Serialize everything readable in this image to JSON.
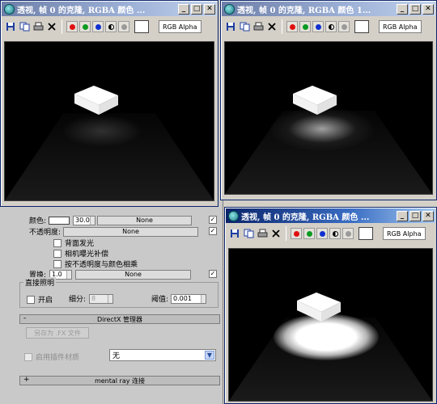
{
  "material_panel": {
    "color_label": "颜色:",
    "color_value": "30.0",
    "none_1": "None",
    "opacity_label": "不透明度:",
    "none_2": "None",
    "backface_label": "背面发光",
    "camera_exposure_label": "相机曝光补偿",
    "opacity_multiply_label": "按不透明度与颜色相乘",
    "displace_label": "置换:",
    "displace_value": "1.0",
    "none_3": "None",
    "direct_light_group": "直接照明",
    "enable_label": "开启",
    "subdiv_label": "细分:",
    "subdiv_value": "8",
    "threshold_label": "阈值:",
    "threshold_value": "0.001",
    "directx_rollout": "DirectX 管理器",
    "directx_rollout_sign": "-",
    "save_fx_button": "另存为 .FX 文件",
    "enable_plugin_label": "启用插件材质",
    "plugin_select_value": "无",
    "mentalray_rollout": "mental ray 连接",
    "mentalray_rollout_sign": "+"
  },
  "windows": [
    {
      "title": "透视, 帧 0 的克隆, RGBA 颜色 ...",
      "channel": "RGB Alpha"
    },
    {
      "title": "透视, 帧 0 的克隆, RGBA 颜色 1...",
      "channel": "RGB Alpha"
    },
    {
      "title": "透视, 帧 0 的克隆, RGBA 颜色 ...",
      "channel": "RGB Alpha"
    }
  ],
  "window_buttons": {
    "minimize": "_",
    "maximize": "□",
    "close": "✕"
  },
  "channel_colors": {
    "red": "#e01010",
    "green": "#0a9a20",
    "blue": "#1030d0"
  },
  "icons": [
    "save-icon",
    "copy-icon",
    "print-icon",
    "clear-icon"
  ],
  "checkmark": "✓"
}
